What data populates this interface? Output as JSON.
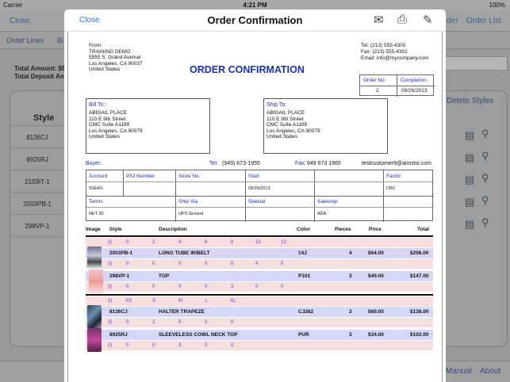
{
  "status_bar": {
    "carrier": "Carrier",
    "time": "4:21 PM",
    "battery": "100%"
  },
  "background": {
    "nav": {
      "close": "Close",
      "order_list": "Order List",
      "partial_right": "der"
    },
    "tabs": {
      "order_lines": "Order Lines",
      "partial_tab": "Bi"
    },
    "totals": {
      "total_amount": "Total Amount: $8",
      "total_deposit": "Total Deposit Am"
    },
    "delete_styles": "Delete Styles",
    "style_header": "Style",
    "styles": [
      "8136CJ",
      "8925RJ",
      "2103IT-1",
      "2003PB-1",
      "298VP-1"
    ],
    "bottom": {
      "manual": "Manual",
      "about": "About"
    }
  },
  "modal": {
    "close_label": "Close",
    "title": "Order Confirmation",
    "icons": [
      "mail-icon",
      "printer-icon",
      "pen-icon"
    ]
  },
  "document": {
    "from": {
      "label": "From:",
      "name": "TRAINING DEMO",
      "street": "5555 S. Grand Avenue",
      "city": "Los Angeles, CA 90037",
      "country": "United States"
    },
    "contact": {
      "tel": "Tel: (213) 555-4300",
      "fax": "Fax: (213) 555-4302",
      "email": "Email: info@mycompany.com"
    },
    "title": "ORDER CONFIRMATION",
    "order_no_label": "Order No",
    "completion_label": "Completion",
    "order_no": "2",
    "completion": "09/26/2013",
    "bill_to": {
      "label": "Bill To:",
      "name": "ABIGAIL PLACE",
      "street": "110 E.9th Street",
      "suite": "CMC Suite A1169",
      "city": "Los Angeles, CA 90079",
      "country": "United States"
    },
    "ship_to": {
      "label": "Ship To:",
      "name": "ABIGAIL PLACE",
      "street": "110 E.9th Street",
      "suite": "CMC Suite A1169",
      "city": "Los Angeles, CA 90079",
      "country": "United States"
    },
    "buyer_label": "Buyer:",
    "tel_label": "Tel:",
    "tel": "(949) 673-1955",
    "fax_label": "Fax:",
    "fax": "949 673 1965",
    "buyer_email": "testcustomer9@aimstsi.com",
    "grid": {
      "account_label": "Account",
      "po_label": "P/O Number",
      "store_label": "Store No.",
      "start_label": "Start",
      "factor_label": "Factor",
      "account": "5SEAS",
      "start": "09/26/2013",
      "factor": "CBC",
      "terms_label": "Terms",
      "shipvia_label": "Ship Via",
      "special_label": "Special",
      "salesrep_label": "Salesrep",
      "terms": "NET 30",
      "shipvia": "UPS Ground",
      "salesrep": "ADA"
    },
    "item_headers": {
      "image": "Image",
      "style": "Style",
      "description": "Description",
      "color": "Color",
      "pieces": "Pieces",
      "price": "Price",
      "total": "Total"
    },
    "size_band_1": {
      "i": "(i)",
      "sizes": [
        "0",
        "2",
        "4",
        "6",
        "8",
        "10",
        "12"
      ]
    },
    "size_band_2": {
      "i": "(i)",
      "sizes": [
        "XS",
        "S",
        "M",
        "L",
        "XL"
      ]
    },
    "items": [
      {
        "style": "2003PB-1",
        "description": "LONG TUBE W/BELT",
        "color": "14J",
        "pieces": "4",
        "price": "$64.00",
        "total": "$256.00",
        "q_i": "(i)",
        "qty": [
          "0",
          "0",
          "0",
          "0",
          "0",
          "4",
          "0"
        ]
      },
      {
        "style": "298VP-1",
        "description": "TOP",
        "color": "P101",
        "pieces": "3",
        "price": "$49.00",
        "total": "$147.00",
        "q_i": "(i)",
        "qty": [
          "0",
          "0",
          "0",
          "0",
          "3",
          "0",
          "0"
        ]
      },
      {
        "style": "8136CJ",
        "description": "HALTER TRAPEZE",
        "color": "CJ262",
        "pieces": "2",
        "price": "$69.00",
        "total": "$138.00",
        "q_i": "(i)",
        "qty": [
          "0",
          "2",
          "0",
          "0",
          "0"
        ]
      },
      {
        "style": "8925RJ",
        "description": "SLEEVELESS COWL NECK TOP",
        "color": "PUR",
        "pieces": "3",
        "price": "$34.00",
        "total": "$102.00",
        "q_i": "(i)",
        "qty": [
          "0",
          "0",
          "3",
          "0",
          "0"
        ]
      }
    ]
  }
}
